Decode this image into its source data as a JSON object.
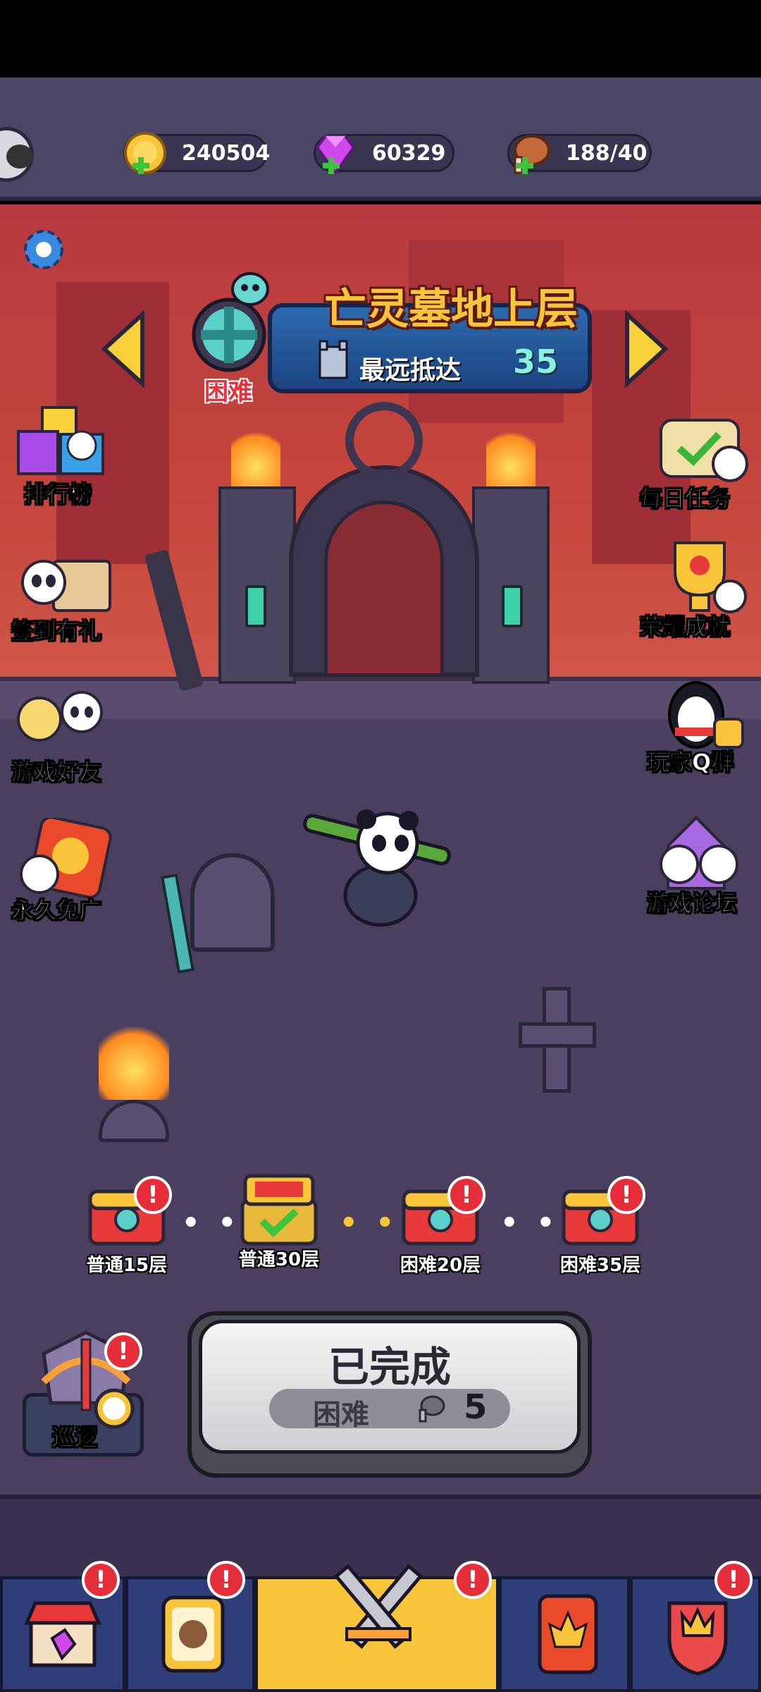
{
  "resources": {
    "gold": "240504",
    "gems": "60329",
    "stamina": "188/40"
  },
  "stage": {
    "title": "亡灵墓地上层",
    "difficulty": "困难",
    "farthest_label": "最远抵达",
    "farthest_value": "35"
  },
  "left_menu": [
    {
      "label": "排行榜",
      "icon": "ranking-icon"
    },
    {
      "label": "签到有礼",
      "icon": "checkin-icon"
    },
    {
      "label": "游戏好友",
      "icon": "friends-icon"
    },
    {
      "label": "永久免广",
      "icon": "no-ads-icon"
    }
  ],
  "right_menu": [
    {
      "label": "每日任务",
      "icon": "daily-task-icon"
    },
    {
      "label": "荣耀成就",
      "icon": "trophy-icon"
    },
    {
      "label": "玩家Q群",
      "icon": "qq-group-icon"
    },
    {
      "label": "游戏论坛",
      "icon": "forum-icon"
    }
  ],
  "chests": [
    {
      "label": "普通15层",
      "alert": "!"
    },
    {
      "label": "普通30层",
      "claimed": true
    },
    {
      "label": "困难20层",
      "alert": "!"
    },
    {
      "label": "困难35层",
      "alert": "!"
    }
  ],
  "patrol": {
    "label": "巡逻",
    "alert": "!"
  },
  "main_button": {
    "label": "已完成",
    "difficulty": "困难",
    "cost": "5"
  },
  "bottom_nav": [
    {
      "name": "shop",
      "icon": "shop-icon",
      "alert": "!"
    },
    {
      "name": "cards",
      "icon": "card-icon",
      "alert": "!"
    },
    {
      "name": "battle",
      "icon": "crossed-swords-icon",
      "alert": "!"
    },
    {
      "name": "book",
      "icon": "book-icon"
    },
    {
      "name": "guild",
      "icon": "guild-icon",
      "alert": "!"
    }
  ],
  "colors": {
    "accent_gold": "#f8c43a",
    "alert_red": "#e62d3a",
    "sky_red": "#b8383c",
    "ground_purple": "#4a3f5e"
  }
}
